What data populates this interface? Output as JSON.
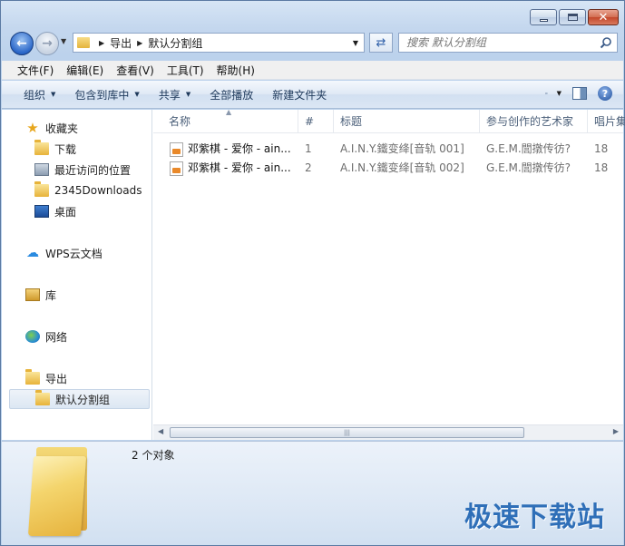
{
  "window": {
    "caption": {
      "minimize": "—",
      "maximize": "□",
      "close": "✕"
    }
  },
  "address": {
    "crumbs": [
      "导出",
      "默认分割组"
    ]
  },
  "search": {
    "placeholder": "搜索 默认分割组"
  },
  "menubar": [
    "文件(F)",
    "编辑(E)",
    "查看(V)",
    "工具(T)",
    "帮助(H)"
  ],
  "commandbar": {
    "organize": "组织",
    "include_in_library": "包含到库中",
    "share": "共享",
    "play_all": "全部播放",
    "new_folder": "新建文件夹"
  },
  "navpane": {
    "favorites": "收藏夹",
    "downloads": "下载",
    "recent": "最近访问的位置",
    "downloads2345": "2345Downloads",
    "desktop": "桌面",
    "wps_cloud": "WPS云文档",
    "libraries": "库",
    "network": "网络",
    "export": "导出",
    "default_group": "默认分割组"
  },
  "columns": {
    "name": "名称",
    "number": "#",
    "title": "标题",
    "artist": "参与创作的艺术家",
    "album": "唱片集"
  },
  "files": [
    {
      "name": "邓紫棋 - 爱你 - ain...",
      "number": "1",
      "title": "A.I.N.Y.鐵变绛[音轨 001]",
      "artist": "G.E.M.閭撴传彷?",
      "album": "18"
    },
    {
      "name": "邓紫棋 - 爱你 - ain...",
      "number": "2",
      "title": "A.I.N.Y.鐵变绛[音轨 002]",
      "artist": "G.E.M.閭撴传彷?",
      "album": "18"
    }
  ],
  "details": {
    "item_count": "2 个对象"
  },
  "watermark": "极速下载站",
  "colors": {
    "accent": "#2f6fb8",
    "mp3_icon": "#e9892a",
    "folder": "#f4d56d"
  }
}
